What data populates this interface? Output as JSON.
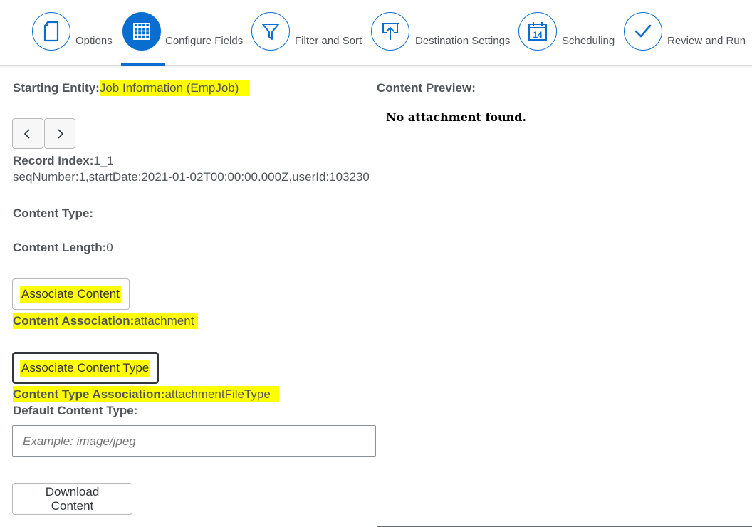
{
  "wizard": {
    "steps": [
      {
        "label": "Options",
        "icon": "document-icon",
        "active": false
      },
      {
        "label": "Configure Fields",
        "icon": "grid-icon",
        "active": true
      },
      {
        "label": "Filter and Sort",
        "icon": "filter-icon",
        "active": false
      },
      {
        "label": "Destination Settings",
        "icon": "upload-icon",
        "active": false
      },
      {
        "label": "Scheduling",
        "icon": "calendar-icon",
        "active": false,
        "icon_text": "14"
      },
      {
        "label": "Review and Run",
        "icon": "checkmark-icon",
        "active": false
      }
    ],
    "accent_color": "#0a6ed1"
  },
  "left": {
    "starting_entity_label": "Starting Entity:",
    "starting_entity_value": "Job Information (EmpJob)",
    "prev_icon": "chevron-left-icon",
    "next_icon": "chevron-right-icon",
    "record_index_label": "Record Index:",
    "record_index_value": "1_1",
    "record_key": "seqNumber:1,startDate:2021-01-02T00:00:00.000Z,userId:103230",
    "content_type_label": "Content Type:",
    "content_type_value": "",
    "content_length_label": "Content Length:",
    "content_length_value": "0",
    "associate_content_button": "Associate Content",
    "content_association_label": "Content Association:",
    "content_association_value": "attachment",
    "associate_content_type_button": "Associate Content Type",
    "content_type_association_label": "Content Type Association:",
    "content_type_association_value": "attachmentFileType",
    "default_content_type_label": "Default Content Type:",
    "default_content_type_value": "",
    "default_content_type_placeholder": "Example: image/jpeg",
    "download_button": "Download Content",
    "highlight_color": "#ffff00"
  },
  "right": {
    "preview_label": "Content Preview:",
    "preview_text": "No attachment found."
  }
}
